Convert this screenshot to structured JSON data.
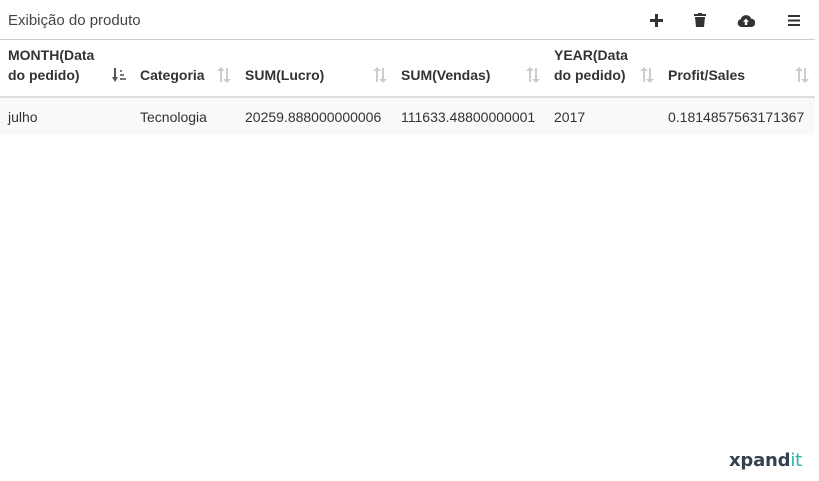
{
  "panel": {
    "title": "Exibição do produto"
  },
  "toolbar": {
    "buttons": [
      {
        "name": "add-icon"
      },
      {
        "name": "trash-icon"
      },
      {
        "name": "cloud-upload-icon"
      },
      {
        "name": "menu-icon"
      }
    ],
    "icon_color": "#333333"
  },
  "table": {
    "columns": [
      {
        "label_line1": "MONTH(Data",
        "label_line2": "do pedido)",
        "sort": "descending-active"
      },
      {
        "label_line1": "Categoria",
        "label_line2": "",
        "sort": "none"
      },
      {
        "label_line1": "SUM(Lucro)",
        "label_line2": "",
        "sort": "none"
      },
      {
        "label_line1": "SUM(Vendas)",
        "label_line2": "",
        "sort": "none"
      },
      {
        "label_line1": "YEAR(Data",
        "label_line2": "do pedido)",
        "sort": "none"
      },
      {
        "label_line1": "Profit/Sales",
        "label_line2": "",
        "sort": "none"
      }
    ],
    "rows": [
      [
        "julho",
        "Tecnologia",
        "20259.888000000006",
        "111633.48800000001",
        "2017",
        "0.1814857563171367"
      ]
    ],
    "row_background": "#f9f9f9"
  },
  "logo": {
    "main_text": "xpand",
    "accent_text": "it",
    "main_color": "#35424e",
    "accent_color": "#29b2a9"
  }
}
